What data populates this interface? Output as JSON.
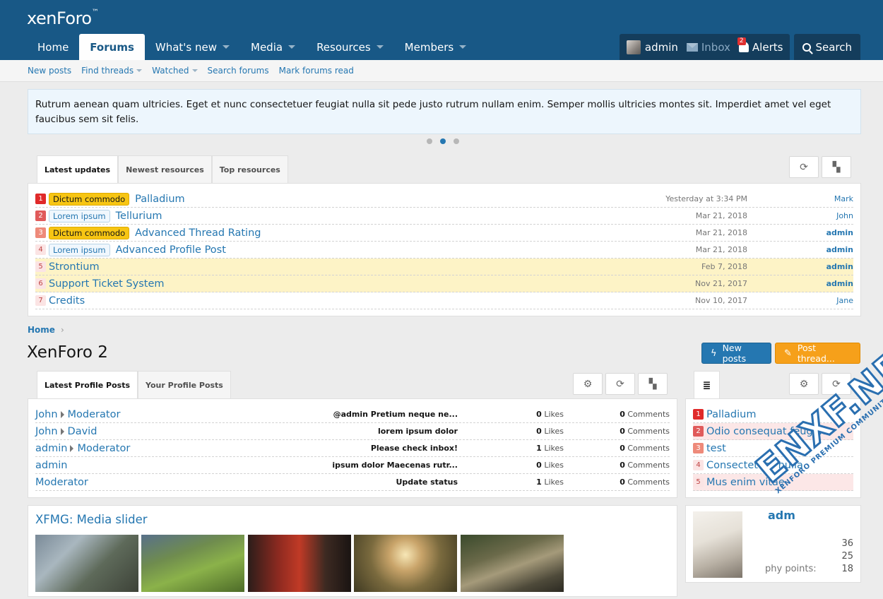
{
  "header": {
    "logo": "xenForo",
    "nav": [
      {
        "label": "Home",
        "dropdown": false
      },
      {
        "label": "Forums",
        "dropdown": false,
        "active": true
      },
      {
        "label": "What's new",
        "dropdown": true
      },
      {
        "label": "Media",
        "dropdown": true
      },
      {
        "label": "Resources",
        "dropdown": true
      },
      {
        "label": "Members",
        "dropdown": true
      }
    ],
    "account": {
      "username": "admin",
      "inbox_label": "Inbox",
      "alerts_label": "Alerts",
      "alerts_count": "2",
      "search_label": "Search"
    }
  },
  "subnav": [
    {
      "label": "New posts",
      "dropdown": false
    },
    {
      "label": "Find threads",
      "dropdown": true
    },
    {
      "label": "Watched",
      "dropdown": true
    },
    {
      "label": "Search forums",
      "dropdown": false
    },
    {
      "label": "Mark forums read",
      "dropdown": false
    }
  ],
  "notice": {
    "text": "Rutrum aenean quam ultricies. Eget et nunc consectetuer feugiat nulla sit pede justo rutrum nullam enim. Semper mollis ultricies montes sit. Imperdiet amet vel eget faucibus sem sit felis.",
    "slides": 3,
    "active_slide": 2
  },
  "resources_block": {
    "tabs": [
      "Latest updates",
      "Newest resources",
      "Top resources"
    ],
    "active_tab": 0,
    "rows": [
      {
        "rank": "1",
        "prefix": "Dictum commodo",
        "prefix_style": "yellow",
        "title": "Palladium",
        "date": "Yesterday at 3:34 PM",
        "user": "Mark",
        "highlight": false,
        "user_bold": false
      },
      {
        "rank": "2",
        "prefix": "Lorem ipsum",
        "prefix_style": "blue",
        "title": "Tellurium",
        "date": "Mar 21, 2018",
        "user": "John",
        "highlight": false,
        "user_bold": false
      },
      {
        "rank": "3",
        "prefix": "Dictum commodo",
        "prefix_style": "yellow",
        "title": "Advanced Thread Rating",
        "date": "Mar 21, 2018",
        "user": "admin",
        "highlight": false,
        "user_bold": true
      },
      {
        "rank": "4",
        "prefix": "Lorem ipsum",
        "prefix_style": "blue",
        "title": "Advanced Profile Post",
        "date": "Mar 21, 2018",
        "user": "admin",
        "highlight": false,
        "user_bold": true
      },
      {
        "rank": "5",
        "prefix": "",
        "prefix_style": "",
        "title": "Strontium",
        "date": "Feb 7, 2018",
        "user": "admin",
        "highlight": true,
        "user_bold": true
      },
      {
        "rank": "6",
        "prefix": "",
        "prefix_style": "",
        "title": "Support Ticket System",
        "date": "Nov 21, 2017",
        "user": "admin",
        "highlight": true,
        "user_bold": true
      },
      {
        "rank": "7",
        "prefix": "",
        "prefix_style": "",
        "title": "Credits",
        "date": "Nov 10, 2017",
        "user": "Jane",
        "highlight": false,
        "user_bold": false
      }
    ]
  },
  "breadcrumb": {
    "home": "Home",
    "chevron": "›"
  },
  "page": {
    "title": "XenForo 2",
    "new_posts_label": "New posts",
    "post_thread_label": "Post thread..."
  },
  "profile_posts_block": {
    "tabs": [
      "Latest Profile Posts",
      "Your Profile Posts"
    ],
    "active_tab": 0,
    "rows": [
      {
        "from": "John",
        "to": "Moderator",
        "message": "@admin Pretium neque ne...",
        "likes": "0",
        "comments": "0"
      },
      {
        "from": "John",
        "to": "David",
        "message": "lorem ipsum dolor",
        "likes": "0",
        "comments": "0"
      },
      {
        "from": "admin",
        "to": "Moderator",
        "message": "Please check inbox!",
        "likes": "1",
        "comments": "0"
      },
      {
        "from": "admin",
        "to": "",
        "message": "ipsum dolor Maecenas rutr...",
        "likes": "0",
        "comments": "0"
      },
      {
        "from": "Moderator",
        "to": "",
        "message": "Update status",
        "likes": "1",
        "comments": "0"
      }
    ],
    "likes_label": "Likes",
    "comments_label": "Comments"
  },
  "side_list": {
    "rows": [
      {
        "rank": "1",
        "title": "Palladium",
        "pink": false
      },
      {
        "rank": "2",
        "title": "Odio consequat feugiat",
        "pink": true
      },
      {
        "rank": "3",
        "title": "test",
        "pink": false
      },
      {
        "rank": "4",
        "title": "Consectetuer nulla",
        "pink": false
      },
      {
        "rank": "5",
        "title": "Mus enim vitae",
        "pink": true
      }
    ]
  },
  "media_block": {
    "title": "XFMG: Media slider",
    "thumb_count": 5
  },
  "member_card": {
    "name": "adm",
    "stats": [
      {
        "label": "",
        "value": "36"
      },
      {
        "label": "",
        "value": "25"
      },
      {
        "label": "phy points:",
        "value": "18"
      }
    ]
  },
  "watermark": {
    "main": "ENXF.NET",
    "sub": "XENFORO PREMIUM COMMUNITY"
  },
  "colors": {
    "header_bg": "#185886",
    "link": "#2577b1",
    "prefix_yellow": "#f7c513",
    "highlight_row": "#fdf3c6",
    "post_thread_button": "#f6a01a"
  }
}
